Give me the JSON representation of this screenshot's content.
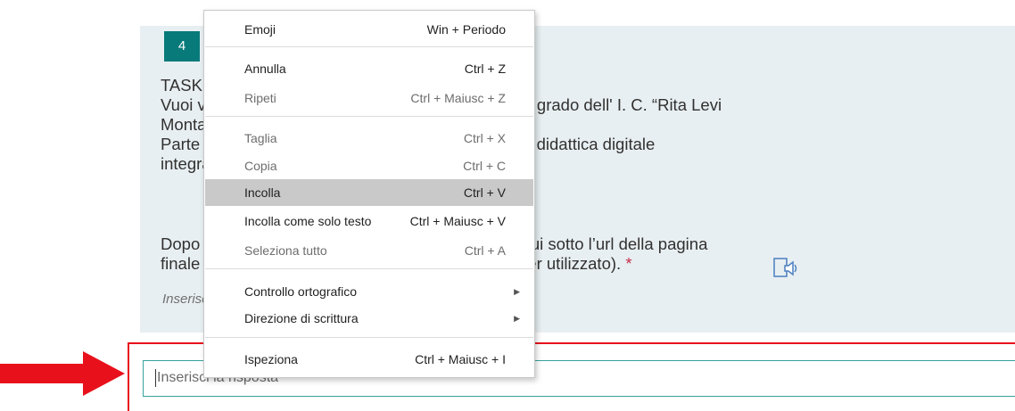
{
  "question": {
    "number": "4",
    "lines": [
      "TASK 3",
      "Vuoi visitare il sito della scuola secondaria di primo grado  dell' I. C. “Rita Levi",
      "Montalcini”.",
      "Parte del testo: trova nel sito l’orario delle lezioni in didattica digitale",
      "integrata.",
      "Dopo aver trovato l'orario, copia e incolla nel box qui sotto l’url della pagina",
      "finale (indirizzo nella barra degli indirizzi del browser utilizzato)."
    ],
    "required_marker": "*",
    "hint": "Inserisci la risposta"
  },
  "answer": {
    "placeholder": "Inserisci la risposta"
  },
  "context_menu": {
    "items": [
      {
        "label": "Emoji",
        "shortcut": "Win + Periodo",
        "state": "enabled"
      },
      {
        "label": "Annulla",
        "shortcut": "Ctrl + Z",
        "state": "enabled"
      },
      {
        "label": "Ripeti",
        "shortcut": "Ctrl + Maiusc + Z",
        "state": "disabled"
      },
      {
        "label": "Taglia",
        "shortcut": "Ctrl + X",
        "state": "disabled"
      },
      {
        "label": "Copia",
        "shortcut": "Ctrl + C",
        "state": "disabled"
      },
      {
        "label": "Incolla",
        "shortcut": "Ctrl + V",
        "state": "highlighted"
      },
      {
        "label": "Incolla come solo testo",
        "shortcut": "Ctrl + Maiusc + V",
        "state": "enabled"
      },
      {
        "label": "Seleziona tutto",
        "shortcut": "Ctrl + A",
        "state": "disabled"
      },
      {
        "label": "Controllo ortografico",
        "submenu": true,
        "state": "enabled"
      },
      {
        "label": "Direzione di scrittura",
        "submenu": true,
        "state": "enabled"
      },
      {
        "label": "Ispeziona",
        "shortcut": "Ctrl + Maiusc + I",
        "state": "enabled"
      }
    ]
  },
  "colors": {
    "accent": "#087a7a",
    "card_background": "#e8eff2",
    "highlight_frame": "#e8111b",
    "input_border": "#38a29c",
    "menu_highlight": "#c9c9c9"
  },
  "icons": {
    "speaker": "immersive-reader-icon",
    "arrow": "red-arrow-icon",
    "submenu": "chevron-right-icon"
  }
}
